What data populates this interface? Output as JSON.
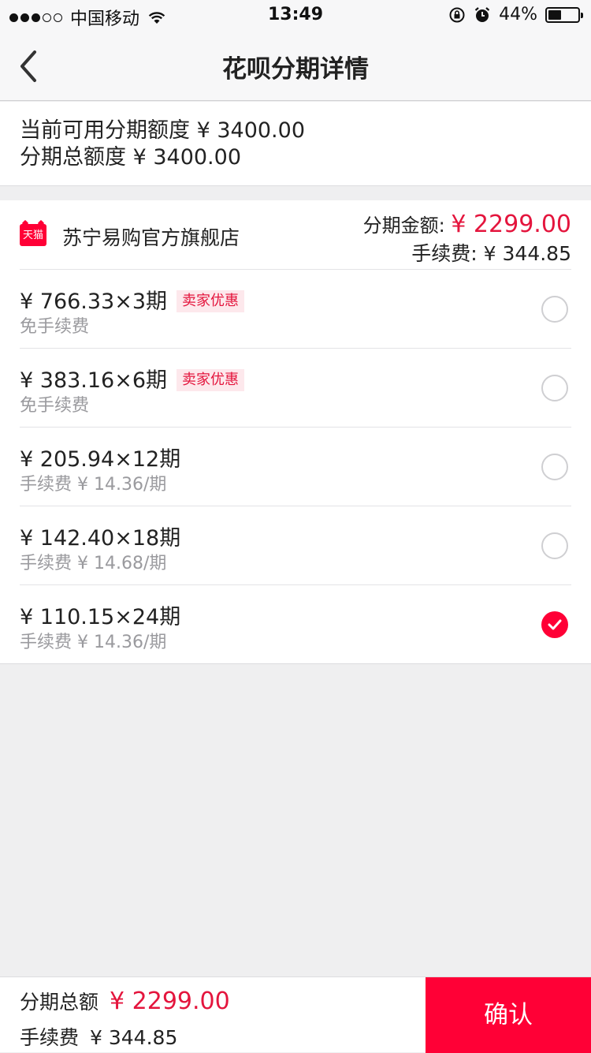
{
  "status_bar": {
    "carrier": "中国移动",
    "time": "13:49",
    "battery": "44%",
    "battery_level": 0.44
  },
  "nav": {
    "title": "花呗分期详情",
    "back_icon": "chevron-left-icon"
  },
  "quota": {
    "available": "当前可用分期额度 ¥ 3400.00",
    "total": "分期总额度 ¥ 3400.00"
  },
  "store": {
    "logo_text": "天猫",
    "name": "苏宁易购官方旗舰店",
    "amount_label": "分期金额:",
    "amount_value": "¥ 2299.00",
    "fee_text": "手续费: ¥ 344.85"
  },
  "options": [
    {
      "price": "¥ 766.33×3期",
      "tag": "卖家优惠",
      "fee": "免手续费",
      "selected": false
    },
    {
      "price": "¥ 383.16×6期",
      "tag": "卖家优惠",
      "fee": "免手续费",
      "selected": false
    },
    {
      "price": "¥ 205.94×12期",
      "tag": "",
      "fee": "手续费 ¥ 14.36/期",
      "selected": false
    },
    {
      "price": "¥ 142.40×18期",
      "tag": "",
      "fee": "手续费 ¥ 14.68/期",
      "selected": false
    },
    {
      "price": "¥ 110.15×24期",
      "tag": "",
      "fee": "手续费 ¥ 14.36/期",
      "selected": true
    }
  ],
  "footer": {
    "total_label": "分期总额",
    "total_value": "¥ 2299.00",
    "fee_label": "手续费",
    "fee_value": "¥ 344.85",
    "confirm_label": "确认"
  },
  "colors": {
    "accent": "#ff0036",
    "price_red": "#e4153d",
    "background": "#efeff0"
  }
}
